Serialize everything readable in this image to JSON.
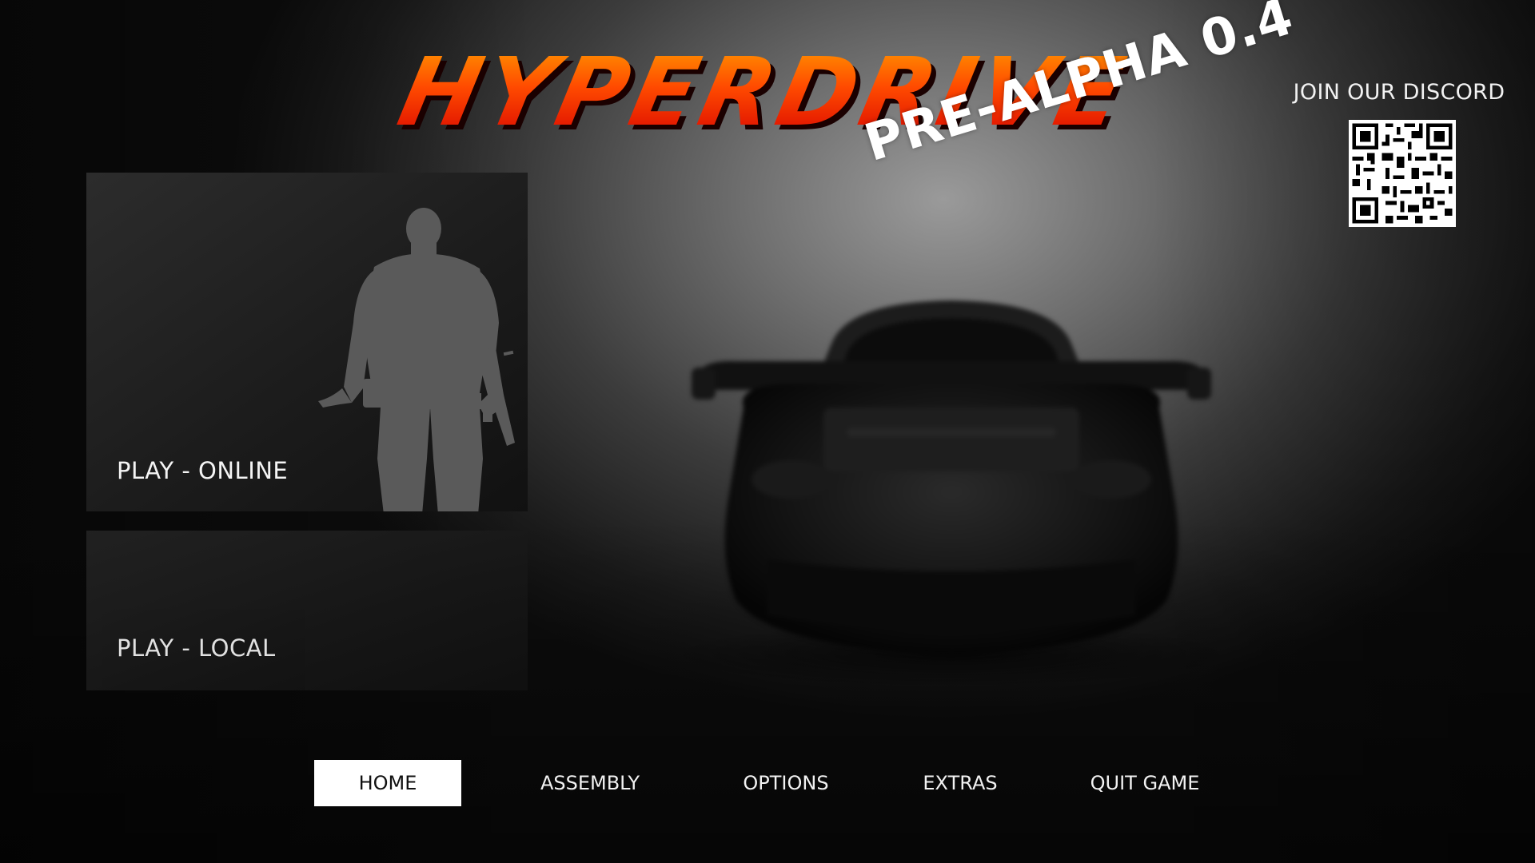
{
  "logo": {
    "title": "HYPERDRIVE",
    "version": "PRE-ALPHA 0.4",
    "gradient_top": "#ff9a00",
    "gradient_bottom": "#e60000"
  },
  "discord": {
    "label": "JOIN OUR DISCORD",
    "qr_icon": "qr-code-icon"
  },
  "menu": {
    "play_online": "PLAY - ONLINE",
    "play_local": "PLAY - LOCAL",
    "online_art_icon": "soldier-silhouette-icon"
  },
  "nav": {
    "items": [
      {
        "label": "HOME",
        "active": true
      },
      {
        "label": "ASSEMBLY",
        "active": false
      },
      {
        "label": "OPTIONS",
        "active": false
      },
      {
        "label": "EXTRAS",
        "active": false
      },
      {
        "label": "QUIT GAME",
        "active": false
      }
    ]
  },
  "background": {
    "scene": "car-silhouette-icon",
    "accent": "#ffffff"
  }
}
